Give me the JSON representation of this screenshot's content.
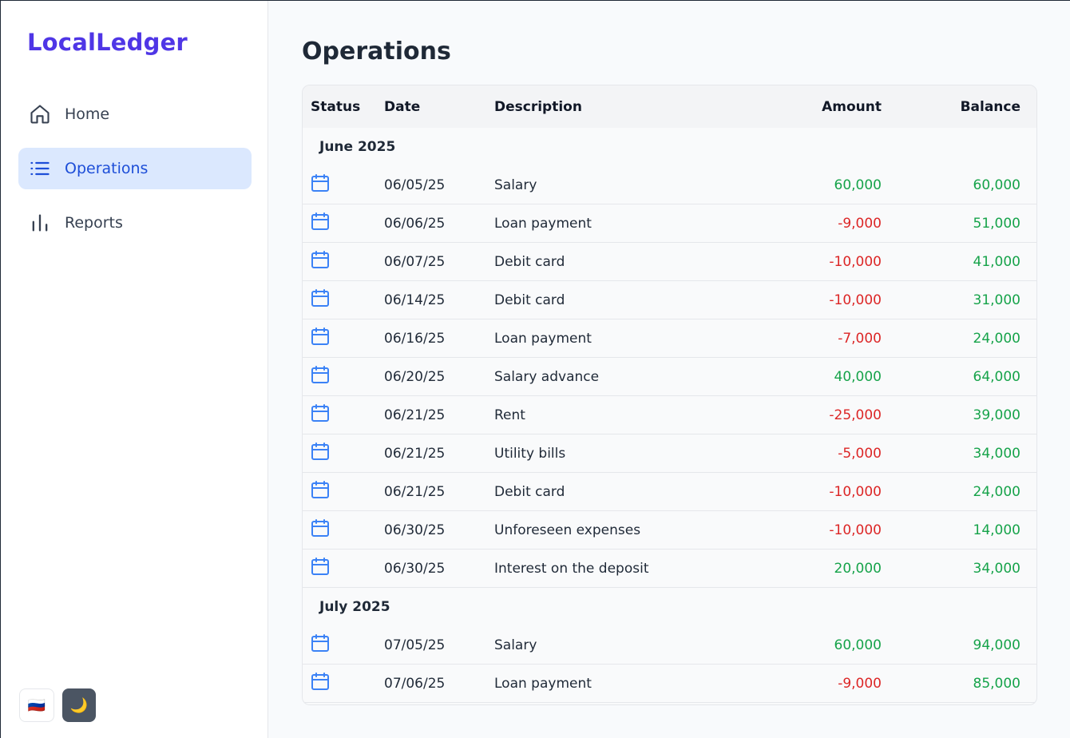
{
  "app": {
    "title": "LocalLedger"
  },
  "sidebar": {
    "items": [
      {
        "label": "Home",
        "icon": "home-icon",
        "active": false
      },
      {
        "label": "Operations",
        "icon": "list-icon",
        "active": true
      },
      {
        "label": "Reports",
        "icon": "bar-chart-icon",
        "active": false
      }
    ],
    "language_flag": "🇷🇺",
    "theme_icon": "🌙"
  },
  "page": {
    "title": "Operations"
  },
  "table": {
    "headers": {
      "status": "Status",
      "date": "Date",
      "description": "Description",
      "amount": "Amount",
      "balance": "Balance"
    },
    "groups": [
      {
        "label": "June 2025",
        "rows": [
          {
            "date": "06/05/25",
            "description": "Salary",
            "amount": "60,000",
            "balance": "60,000",
            "sign": "pos"
          },
          {
            "date": "06/06/25",
            "description": "Loan payment",
            "amount": "-9,000",
            "balance": "51,000",
            "sign": "neg"
          },
          {
            "date": "06/07/25",
            "description": "Debit card",
            "amount": "-10,000",
            "balance": "41,000",
            "sign": "neg"
          },
          {
            "date": "06/14/25",
            "description": "Debit card",
            "amount": "-10,000",
            "balance": "31,000",
            "sign": "neg"
          },
          {
            "date": "06/16/25",
            "description": "Loan payment",
            "amount": "-7,000",
            "balance": "24,000",
            "sign": "neg"
          },
          {
            "date": "06/20/25",
            "description": "Salary advance",
            "amount": "40,000",
            "balance": "64,000",
            "sign": "pos"
          },
          {
            "date": "06/21/25",
            "description": "Rent",
            "amount": "-25,000",
            "balance": "39,000",
            "sign": "neg"
          },
          {
            "date": "06/21/25",
            "description": "Utility bills",
            "amount": "-5,000",
            "balance": "34,000",
            "sign": "neg"
          },
          {
            "date": "06/21/25",
            "description": "Debit card",
            "amount": "-10,000",
            "balance": "24,000",
            "sign": "neg"
          },
          {
            "date": "06/30/25",
            "description": "Unforeseen expenses",
            "amount": "-10,000",
            "balance": "14,000",
            "sign": "neg"
          },
          {
            "date": "06/30/25",
            "description": "Interest on the deposit",
            "amount": "20,000",
            "balance": "34,000",
            "sign": "pos"
          }
        ]
      },
      {
        "label": "July 2025",
        "rows": [
          {
            "date": "07/05/25",
            "description": "Salary",
            "amount": "60,000",
            "balance": "94,000",
            "sign": "pos"
          },
          {
            "date": "07/06/25",
            "description": "Loan payment",
            "amount": "-9,000",
            "balance": "85,000",
            "sign": "neg"
          }
        ]
      }
    ]
  },
  "colors": {
    "brand": "#4f36e6",
    "active_nav_bg": "#dbe8fe",
    "positive": "#16a34a",
    "negative": "#dc2626",
    "status_icon": "#3b82f6"
  }
}
